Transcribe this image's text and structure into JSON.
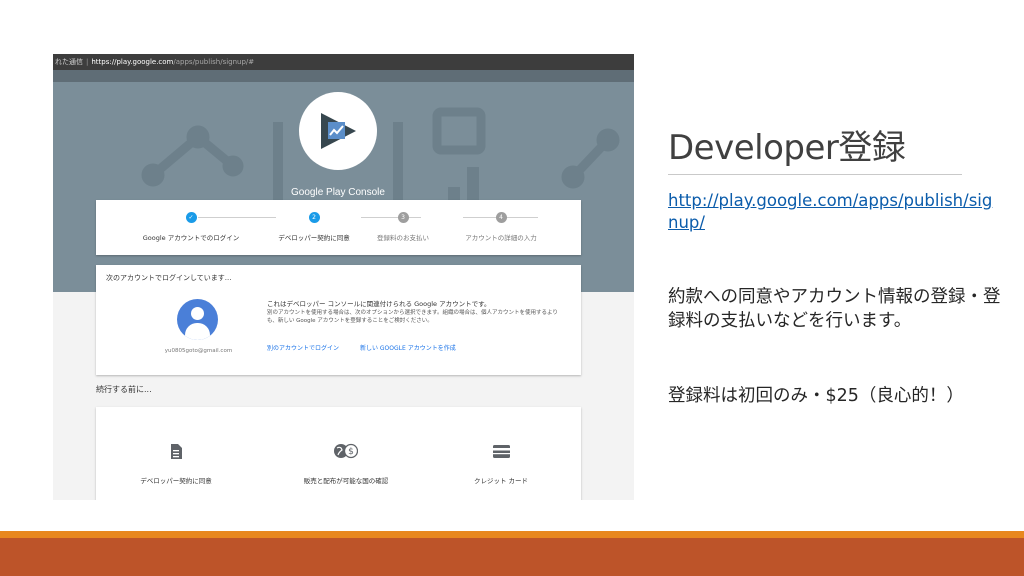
{
  "browser": {
    "tab_fragment": "れた通信",
    "url_host": "https://play.google.com",
    "url_path": "/apps/publish/signup/#"
  },
  "console": {
    "brand": "Google Play Console",
    "steps": [
      {
        "label": "Google アカウントでのログイン",
        "marker": "✓",
        "state": "done"
      },
      {
        "label": "デベロッパー契約に同意",
        "marker": "2",
        "state": "active"
      },
      {
        "label": "登録料のお支払い",
        "marker": "3",
        "state": "todo"
      },
      {
        "label": "アカウントの詳細の入力",
        "marker": "4",
        "state": "todo"
      }
    ],
    "login": {
      "title": "次のアカウントでログインしています...",
      "email": "yu0805goto@gmail.com",
      "main": "これはデベロッパー コンソールに関連付けられる Google アカウントです。",
      "sub": "別のアカウントを使用する場合は、次のオプションから選択できます。組織の場合は、個人アカウントを使用するよりも、新しい Google アカウントを登録することをご検討ください。",
      "link_other": "別のアカウントでログイン",
      "link_new": "新しい GOOGLE アカウントを作成"
    },
    "before": {
      "title": "続行する前に...",
      "items": [
        {
          "label": "デベロッパー契約に同意",
          "icon": "document-icon"
        },
        {
          "label": "販売と配布が可能な国の確認",
          "icon": "globe-dollar-icon"
        },
        {
          "label": "クレジット カード",
          "icon": "credit-card-icon"
        }
      ]
    }
  },
  "slide": {
    "title": "Developer登録",
    "url": "http://play.google.com/apps/publish/signup/",
    "desc": "約款への同意やアカウント情報の登録・登録料の支払いなどを行います。",
    "fee": "登録料は初回のみ・$25（良心的！）"
  },
  "colors": {
    "accent_blue": "#1a9be8",
    "hero_bg": "#7b8e99",
    "footer_orange": "#e8871e",
    "footer_red": "#bd5429"
  }
}
